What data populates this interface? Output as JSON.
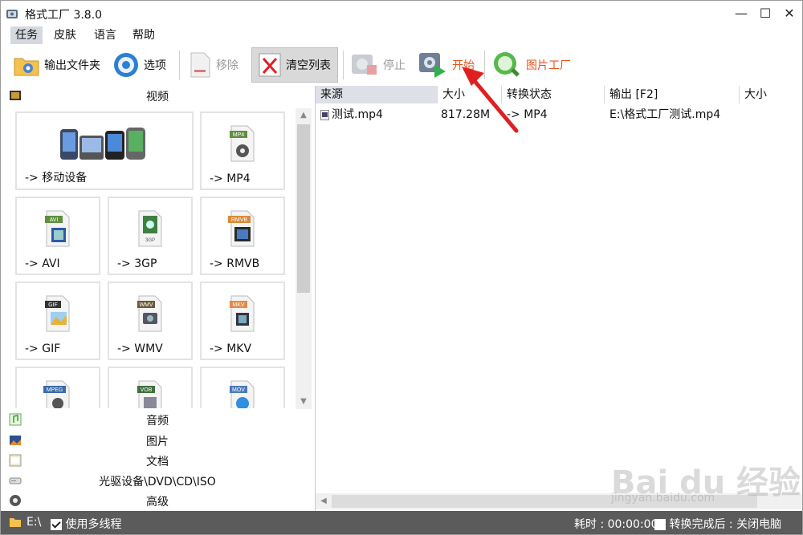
{
  "window": {
    "title": "格式工厂 3.8.0"
  },
  "menu": [
    "任务",
    "皮肤",
    "语言",
    "帮助"
  ],
  "toolbar": {
    "output_folder": "输出文件夹",
    "options": "选项",
    "remove": "移除",
    "clear_list": "清空列表",
    "stop": "停止",
    "start": "开始",
    "picture_factory": "图片工厂"
  },
  "left": {
    "video_title": "视频",
    "tiles": [
      {
        "label": "-> 移动设备",
        "icon": "mobile-devices-icon",
        "badge": ""
      },
      {
        "label": "-> MP4",
        "icon": "mp4-file-icon",
        "badge": "MP4"
      },
      {
        "label": "-> AVI",
        "icon": "avi-file-icon",
        "badge": "AVI"
      },
      {
        "label": "-> 3GP",
        "icon": "3gp-file-icon",
        "badge": "3GP"
      },
      {
        "label": "-> RMVB",
        "icon": "rmvb-file-icon",
        "badge": "RMVB"
      },
      {
        "label": "-> GIF",
        "icon": "gif-file-icon",
        "badge": "GIF"
      },
      {
        "label": "-> WMV",
        "icon": "wmv-file-icon",
        "badge": "WMV"
      },
      {
        "label": "-> MKV",
        "icon": "mkv-file-icon",
        "badge": "MKV"
      },
      {
        "label": "",
        "icon": "mpeg-file-icon",
        "badge": "MPEG"
      },
      {
        "label": "",
        "icon": "vob-file-icon",
        "badge": "VOB"
      },
      {
        "label": "",
        "icon": "mov-file-icon",
        "badge": "MOV"
      }
    ],
    "categories": [
      "音频",
      "图片",
      "文档",
      "光驱设备\\DVD\\CD\\ISO",
      "高级"
    ]
  },
  "list": {
    "headers": [
      "来源",
      "大小",
      "转换状态",
      "输出 [F2]",
      "大小"
    ],
    "rows": [
      {
        "source": "测试.mp4",
        "size": "817.28M",
        "status": "-> MP4",
        "output": "E:\\格式工厂测试.mp4",
        "outsize": ""
      }
    ]
  },
  "status": {
    "drive": "E:\\",
    "multithread": "使用多线程",
    "elapsed": "耗时 : 00:00:00",
    "after_done": "转换完成后 : 关闭电脑"
  },
  "watermark": {
    "logo": "Bai du 经验",
    "url": "jingyan.baidu.com"
  },
  "colors": {
    "start_label": "#e8531e",
    "picture_factory_label": "#e8531e",
    "arrow": "#e02020"
  }
}
